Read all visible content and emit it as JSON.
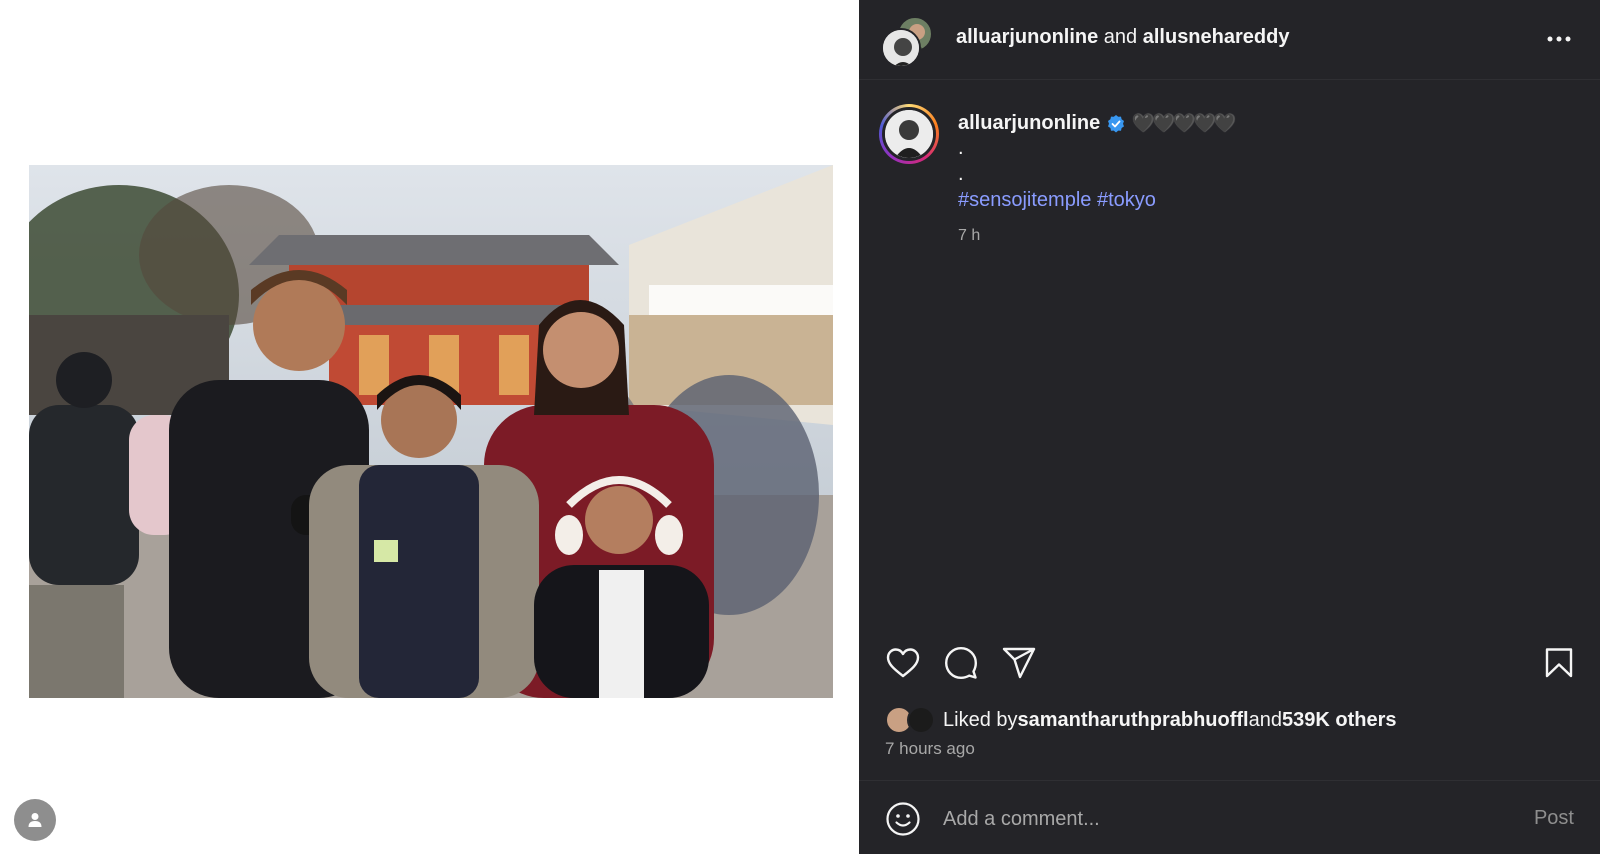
{
  "header": {
    "user1": "alluarjunonline",
    "joiner": " and ",
    "user2": "allusnehareddy",
    "more_icon": "more-horizontal-icon"
  },
  "caption": {
    "username": "alluarjunonline",
    "hearts": "🖤🖤🖤🖤🖤",
    "dot1": ".",
    "dot2": ".",
    "hashtag1": "#sensojitemple",
    "hashtag2": "#tokyo",
    "time": "7 h"
  },
  "actions": {
    "like_icon": "heart-icon",
    "comment_icon": "comment-icon",
    "share_icon": "share-icon",
    "save_icon": "bookmark-icon"
  },
  "likes": {
    "prefix": "Liked by ",
    "user": "samantharuthprabhuoffl",
    "joiner": " and ",
    "count": "539K others"
  },
  "posted": "7 hours ago",
  "comment": {
    "placeholder": "Add a comment...",
    "post_label": "Post"
  },
  "colors": {
    "panel_bg": "#242428",
    "hashtag": "#8a9cff",
    "verified": "#3897f0"
  }
}
